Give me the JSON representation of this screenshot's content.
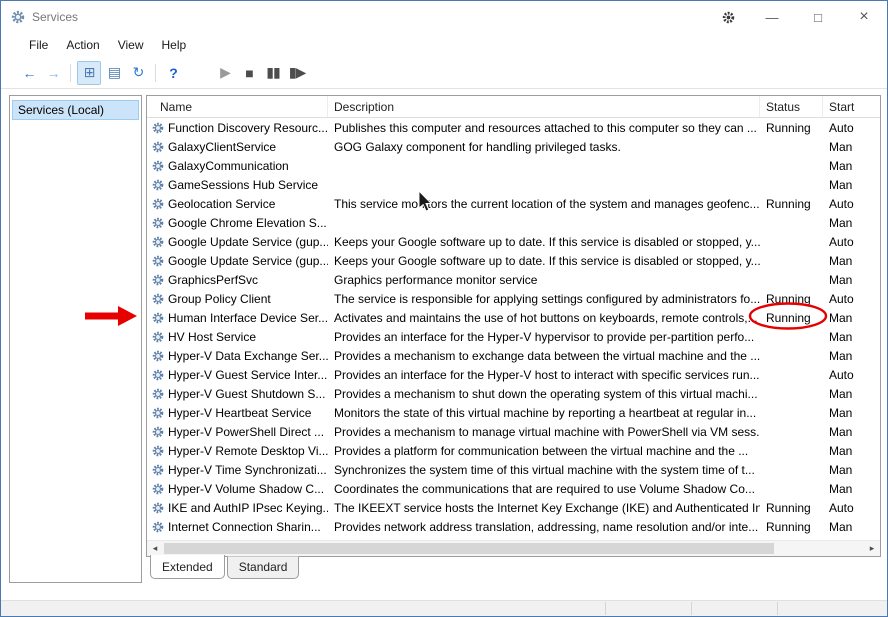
{
  "window": {
    "title": "Services",
    "controls": {
      "minimize": "—",
      "maximize": "□",
      "close": "×"
    }
  },
  "menubar": {
    "items": [
      "File",
      "Action",
      "View",
      "Help"
    ]
  },
  "toolbar": {
    "buttons": [
      {
        "name": "back-button",
        "glyph": "←",
        "color": "#2a7ac7"
      },
      {
        "name": "forward-button",
        "glyph": "→",
        "color": "#85b6e2"
      },
      {
        "type": "separator"
      },
      {
        "name": "show-console-tree-button",
        "glyph": "⊞",
        "color": "#4a7ab0",
        "pressed": true
      },
      {
        "name": "export-list-button",
        "glyph": "▤",
        "color": "#4a7ab0"
      },
      {
        "name": "refresh-button",
        "glyph": "↻",
        "color": "#2a7ac7"
      },
      {
        "type": "separator"
      },
      {
        "name": "help-button",
        "glyph": "?",
        "color": "#1f5fd0",
        "bold": true
      },
      {
        "type": "gap"
      },
      {
        "name": "start-service-button",
        "glyph": "▶",
        "color": "#9a9a9a"
      },
      {
        "name": "stop-service-button",
        "glyph": "■",
        "color": "#4d4d4d"
      },
      {
        "name": "pause-service-button",
        "glyph": "▮▮",
        "color": "#4d4d4d"
      },
      {
        "name": "restart-service-button",
        "glyph": "▮▶",
        "color": "#4d4d4d"
      }
    ]
  },
  "sidebar": {
    "root_label": "Services (Local)"
  },
  "list": {
    "columns": [
      {
        "label": "Name"
      },
      {
        "label": "Description"
      },
      {
        "label": "Status"
      },
      {
        "label": "Start"
      }
    ],
    "rows": [
      {
        "name": "Function Discovery Resourc...",
        "description": "Publishes this computer and resources attached to this computer so they can ...",
        "status": "Running",
        "startup": "Auto"
      },
      {
        "name": "GalaxyClientService",
        "description": "GOG Galaxy component for handling privileged tasks.",
        "status": "",
        "startup": "Man"
      },
      {
        "name": "GalaxyCommunication",
        "description": "",
        "status": "",
        "startup": "Man"
      },
      {
        "name": "GameSessions Hub Service",
        "description": "",
        "status": "",
        "startup": "Man"
      },
      {
        "name": "Geolocation Service",
        "description": "This service monitors the current location of the system and manages geofenc...",
        "status": "Running",
        "startup": "Auto"
      },
      {
        "name": "Google Chrome Elevation S...",
        "description": "",
        "status": "",
        "startup": "Man"
      },
      {
        "name": "Google Update Service (gup...",
        "description": "Keeps your Google software up to date. If this service is disabled or stopped, y...",
        "status": "",
        "startup": "Auto"
      },
      {
        "name": "Google Update Service (gup...",
        "description": "Keeps your Google software up to date. If this service is disabled or stopped, y...",
        "status": "",
        "startup": "Man"
      },
      {
        "name": "GraphicsPerfSvc",
        "description": "Graphics performance monitor service",
        "status": "",
        "startup": "Man"
      },
      {
        "name": "Group Policy Client",
        "description": "The service is responsible for applying settings configured by administrators fo...",
        "status": "Running",
        "startup": "Auto"
      },
      {
        "name": "Human Interface Device Ser...",
        "description": "Activates and maintains the use of hot buttons on keyboards, remote controls,...",
        "status": "Running",
        "startup": "Man"
      },
      {
        "name": "HV Host Service",
        "description": "Provides an interface for the Hyper-V hypervisor to provide per-partition perfo...",
        "status": "",
        "startup": "Man"
      },
      {
        "name": "Hyper-V Data Exchange Ser...",
        "description": "Provides a mechanism to exchange data between the virtual machine and the ...",
        "status": "",
        "startup": "Man"
      },
      {
        "name": "Hyper-V Guest Service Inter...",
        "description": "Provides an interface for the Hyper-V host to interact with specific services run...",
        "status": "",
        "startup": "Auto"
      },
      {
        "name": "Hyper-V Guest Shutdown S...",
        "description": "Provides a mechanism to shut down the operating system of this virtual machi...",
        "status": "",
        "startup": "Man"
      },
      {
        "name": "Hyper-V Heartbeat Service",
        "description": "Monitors the state of this virtual machine by reporting a heartbeat at regular in...",
        "status": "",
        "startup": "Man"
      },
      {
        "name": "Hyper-V PowerShell Direct ...",
        "description": "Provides a mechanism to manage virtual machine with PowerShell via VM sess...",
        "status": "",
        "startup": "Man"
      },
      {
        "name": "Hyper-V Remote Desktop Vi...",
        "description": "Provides a platform for communication between the virtual machine and the ...",
        "status": "",
        "startup": "Man"
      },
      {
        "name": "Hyper-V Time Synchronizati...",
        "description": "Synchronizes the system time of this virtual machine with the system time of t...",
        "status": "",
        "startup": "Man"
      },
      {
        "name": "Hyper-V Volume Shadow C...",
        "description": "Coordinates the communications that are required to use Volume Shadow Co...",
        "status": "",
        "startup": "Man"
      },
      {
        "name": "IKE and AuthIP IPsec Keying...",
        "description": "The IKEEXT service hosts the Internet Key Exchange (IKE) and Authenticated Int...",
        "status": "Running",
        "startup": "Auto"
      },
      {
        "name": "Internet Connection Sharin...",
        "description": "Provides network address translation, addressing, name resolution and/or inte...",
        "status": "Running",
        "startup": "Man"
      }
    ]
  },
  "scrollbar": {
    "left_glyph": "◂",
    "right_glyph": "▸"
  },
  "tabs": [
    {
      "label": "Extended",
      "active": true
    },
    {
      "label": "Standard",
      "active": false
    }
  ],
  "annotations": {
    "color": "#e60000",
    "arrow_target_row": "Human Interface Device Ser...",
    "circled_status": "Running"
  }
}
